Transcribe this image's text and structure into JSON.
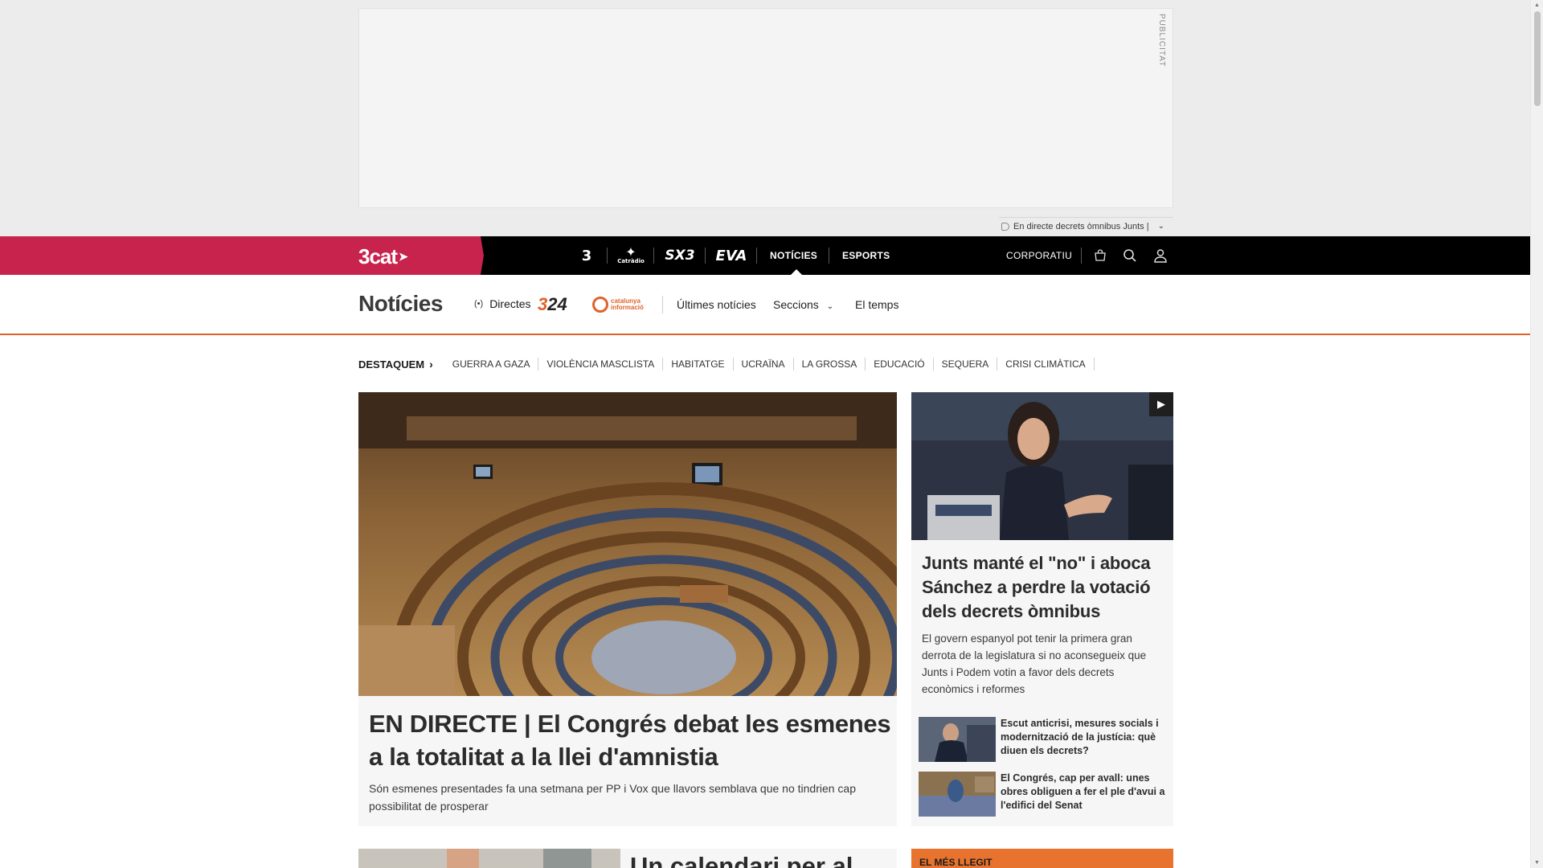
{
  "ad": {
    "label": "PUBLICITAT",
    "ticker_text": "En directe decrets òmnibus Junts |"
  },
  "topbar": {
    "brand": "3cat",
    "channels": [
      "3",
      "Cat",
      "SX3",
      "EVA"
    ],
    "channel_cat_caption": "Catràdio",
    "links": {
      "noticies": "NOTÍCIES",
      "esports": "ESPORTS",
      "corporatiu": "CORPORATIU"
    }
  },
  "section": {
    "title": "Notícies",
    "directes": "Directes",
    "logo_324": "324",
    "logo_ci": "catalunya informació",
    "links": [
      "Últimes notícies",
      "Seccions",
      "El temps"
    ]
  },
  "destaquem": {
    "lead": "DESTAQUEM",
    "items": [
      "GUERRA A GAZA",
      "VIOLÈNCIA MASCLISTA",
      "HABITATGE",
      "UCRAÏNA",
      "LA GROSSA",
      "EDUCACIÓ",
      "SEQUERA",
      "CRISI CLIMÀTICA"
    ]
  },
  "main_story": {
    "headline": "EN DIRECTE | El Congrés debat les esmenes a la totalitat a la llei d'amnistia",
    "summary": "Són esmenes presentades fa una setmana per PP i Vox que llavors semblava que no tindrien cap possibilitat de prosperar"
  },
  "side_story": {
    "headline": "Junts manté el \"no\" i aboca Sánchez a perdre la votació dels decrets òmnibus",
    "summary": "El govern espanyol pot tenir la primera gran derrota de la legislatura si no aconsegueix que Junts i Podem votin a favor dels decrets econòmics i reformes",
    "related": [
      "Escut anticrisi, mesures socials i modernització de la justícia: què diuen els decrets?",
      "El Congrés, cap per avall: unes obres obliguen a fer el ple d'avui a l'edifici del Senat"
    ]
  },
  "bottom": {
    "left_title": "Un calendari per al",
    "most_read": "EL MÉS LLEGIT"
  },
  "colors": {
    "brand": "#c8234d",
    "accent_orange": "#e0622a",
    "topbar": "#000000"
  }
}
